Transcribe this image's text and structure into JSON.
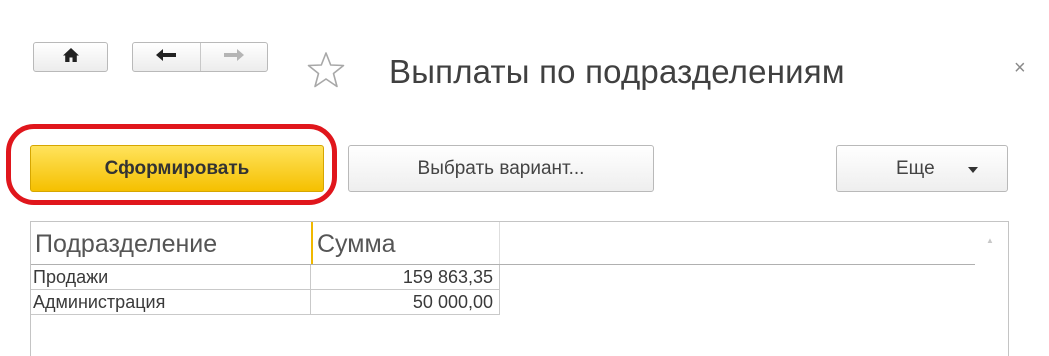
{
  "window": {
    "title": "Выплаты по подразделениям",
    "close_glyph": "×"
  },
  "icons": {
    "home": "home-icon",
    "back": "back-arrow-icon",
    "forward": "forward-arrow-icon",
    "favorite": "star-outline-icon",
    "more_dropdown": "dropdown-triangle-icon"
  },
  "command_bar": {
    "generate_label": "Сформировать",
    "choose_variant_label": "Выбрать вариант...",
    "more_label": "Еще"
  },
  "colors": {
    "primary_button": "#f5c000",
    "highlight": "#e0161c",
    "column_marker": "#f0b800"
  },
  "report": {
    "columns": [
      "Подразделение",
      "Сумма"
    ],
    "rows": [
      {
        "department": "Продажи",
        "amount": "159 863,35"
      },
      {
        "department": "Администрация",
        "amount": "50 000,00"
      }
    ]
  }
}
